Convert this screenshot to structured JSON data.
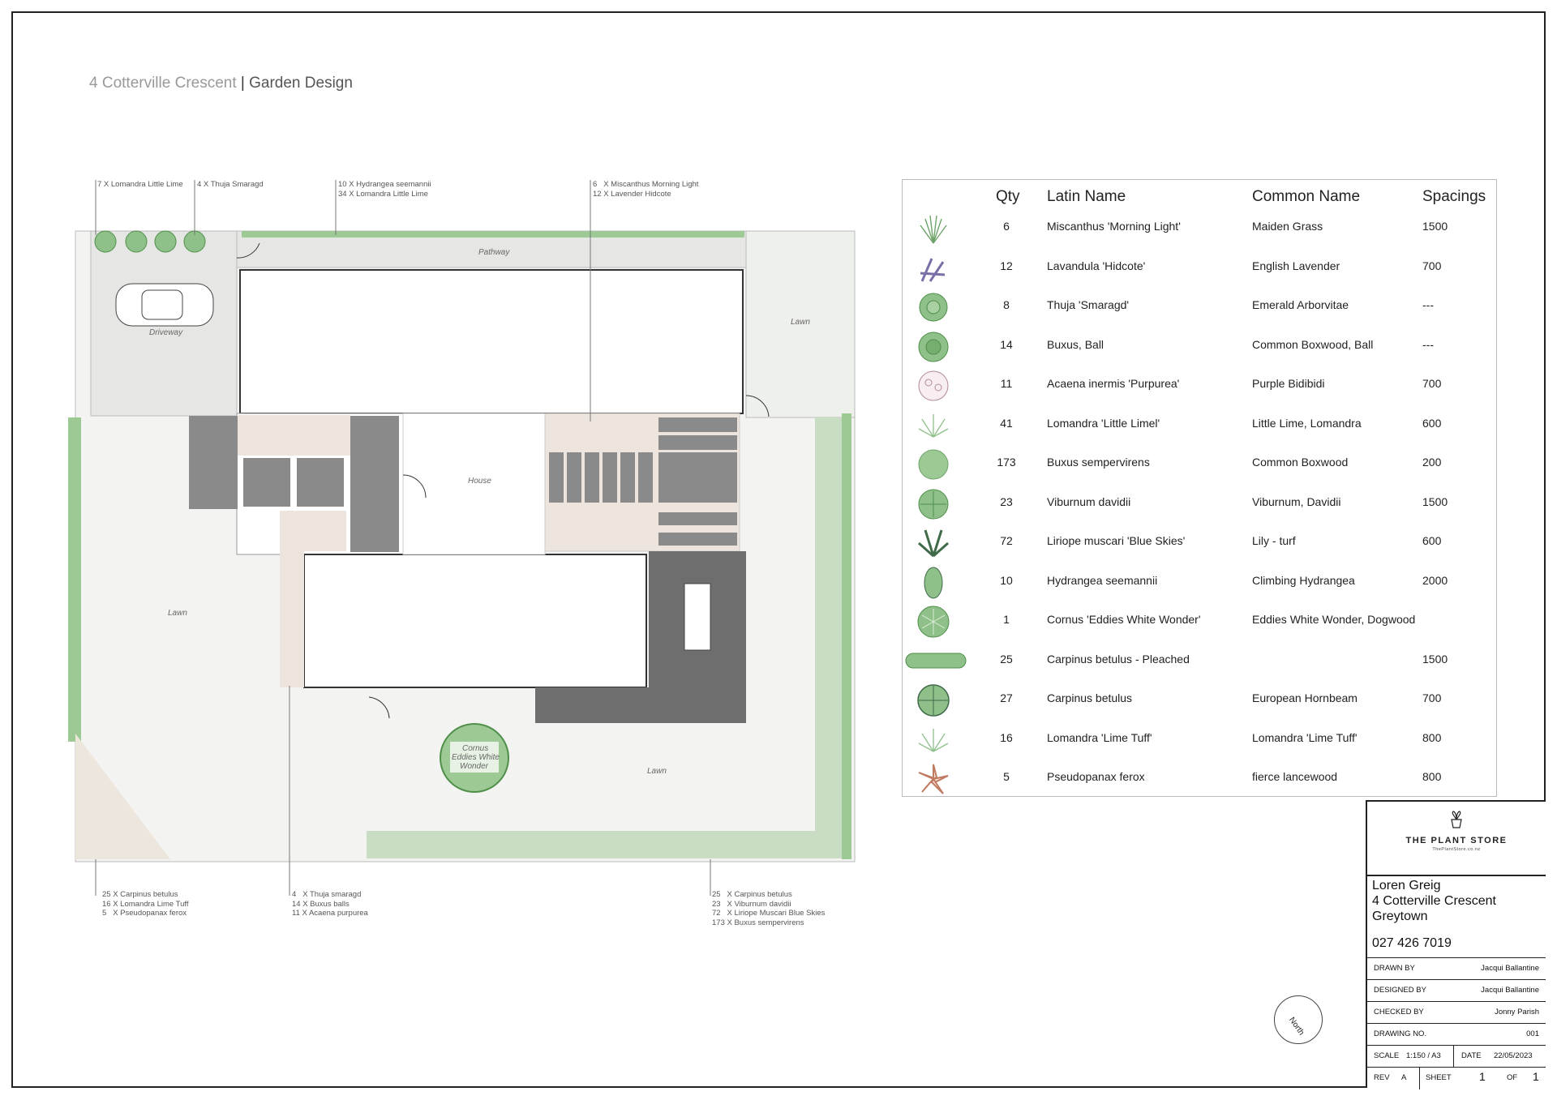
{
  "title": {
    "address": "4 Cotterville Crescent",
    "separator": "|",
    "subtitle": "Garden Design"
  },
  "callouts": {
    "top_1": "7 X Lomandra Little Lime",
    "top_2": "4 X Thuja Smaragd",
    "top_3": "10 X Hydrangea seemannii\n34 X Lomandra Little Lime",
    "top_4": "6   X Miscanthus Morning Light\n12 X Lavender Hidcote",
    "bottom_1": "25 X Carpinus betulus\n16 X Lomandra Lime Tuff\n5   X Pseudopanax ferox",
    "bottom_2": "4   X Thuja smaragd\n14 X Buxus balls\n11 X Acaena purpurea",
    "bottom_3": "25   X Carpinus betulus\n23   X Viburnum davidii\n72   X Liriope Muscari Blue Skies\n173 X Buxus sempervirens"
  },
  "plan": {
    "labels": {
      "pathway": "Pathway",
      "driveway": "Driveway",
      "lawn_ne": "Lawn",
      "lawn_w": "Lawn",
      "lawn_s": "Lawn",
      "house": "House",
      "feature_tree": [
        "Cornus",
        "Eddies White",
        "Wonder"
      ]
    }
  },
  "schedule": {
    "headers": {
      "qty": "Qty",
      "latin": "Latin Name",
      "common": "Common Name",
      "spacing": "Spacings"
    },
    "rows": [
      {
        "icon": "ornamental-grass-icon",
        "qty": "6",
        "latin": "Miscanthus 'Morning Light'",
        "common": "Maiden Grass",
        "spacing": "1500"
      },
      {
        "icon": "lavender-icon",
        "qty": "12",
        "latin": "Lavandula 'Hidcote'",
        "common": "English Lavender",
        "spacing": "700"
      },
      {
        "icon": "conifer-icon",
        "qty": "8",
        "latin": "Thuja 'Smaragd'",
        "common": "Emerald Arborvitae",
        "spacing": "---"
      },
      {
        "icon": "shrub-ball-icon",
        "qty": "14",
        "latin": "Buxus, Ball",
        "common": "Common Boxwood, Ball",
        "spacing": "---"
      },
      {
        "icon": "groundcover-icon",
        "qty": "11",
        "latin": "Acaena inermis 'Purpurea'",
        "common": "Purple Bidibidi",
        "spacing": "700"
      },
      {
        "icon": "grass-tuft-icon",
        "qty": "41",
        "latin": "Lomandra 'Little Limel'",
        "common": "Little Lime, Lomandra",
        "spacing": "600"
      },
      {
        "icon": "hedge-plant-icon",
        "qty": "173",
        "latin": "Buxus sempervirens",
        "common": "Common Boxwood",
        "spacing": "200"
      },
      {
        "icon": "viburnum-icon",
        "qty": "23",
        "latin": "Viburnum davidii",
        "common": "Viburnum, Davidii",
        "spacing": "1500"
      },
      {
        "icon": "liriope-icon",
        "qty": "72",
        "latin": "Liriope muscari 'Blue Skies'",
        "common": "Lily - turf",
        "spacing": "600"
      },
      {
        "icon": "climber-icon",
        "qty": "10",
        "latin": "Hydrangea seemannii",
        "common": "Climbing Hydrangea",
        "spacing": "2000"
      },
      {
        "icon": "tree-icon",
        "qty": "1",
        "latin": "Cornus 'Eddies White Wonder'",
        "common": "Eddies White Wonder, Dogwood",
        "spacing": ""
      },
      {
        "icon": "pleached-hedge-icon",
        "qty": "25",
        "latin": "Carpinus betulus - Pleached",
        "common": "",
        "spacing": "1500"
      },
      {
        "icon": "hornbeam-icon",
        "qty": "27",
        "latin": "Carpinus betulus",
        "common": "European Hornbeam",
        "spacing": "700"
      },
      {
        "icon": "grass-tuft-icon",
        "qty": "16",
        "latin": "Lomandra 'Lime Tuff'",
        "common": "Lomandra 'Lime Tuff'",
        "spacing": "800"
      },
      {
        "icon": "spiky-plant-icon",
        "qty": "5",
        "latin": "Pseudopanax ferox",
        "common": "fierce lancewood",
        "spacing": "800"
      }
    ]
  },
  "title_block": {
    "company": "THE PLANT STORE",
    "company_url": "ThePlantStore.co.nz",
    "client_name": "Loren Greig",
    "client_address_1": "4 Cotterville Crescent",
    "client_address_2": "Greytown",
    "client_phone": "027 426 7019",
    "drawn_by_label": "DRAWN BY",
    "drawn_by": "Jacqui Ballantine",
    "designed_by_label": "DESIGNED BY",
    "designed_by": "Jacqui Ballantine",
    "checked_by_label": "CHECKED BY",
    "checked_by": "Jonny Parish",
    "drawing_no_label": "DRAWING NO.",
    "drawing_no": "001",
    "scale_label": "SCALE",
    "scale": "1:150 / A3",
    "date_label": "DATE",
    "date": "22/05/2023",
    "rev_label": "REV",
    "rev": "A",
    "sheet_label": "SHEET",
    "sheet": "1",
    "of_label": "OF",
    "of": "1"
  },
  "north_label": "North",
  "colors": {
    "lawn": "#eef0ec",
    "paving": "#8a8a8a",
    "house": "#ffffff",
    "bed": "#ede4dd",
    "plant": "#8fc08a",
    "plant_dark": "#4f8f4a"
  }
}
